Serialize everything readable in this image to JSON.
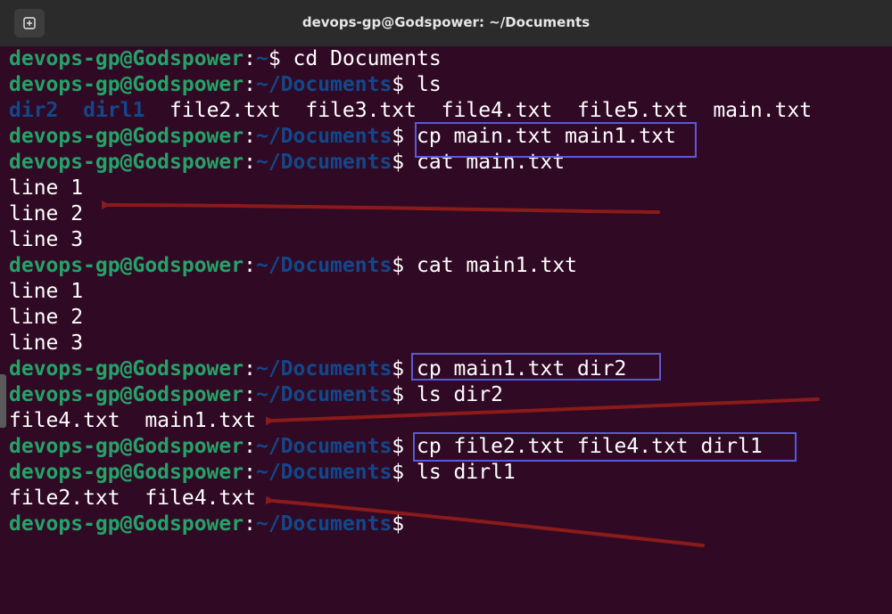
{
  "window": {
    "title": "devops-gp@Godspower: ~/Documents"
  },
  "prompt": {
    "user": "devops-gp@Godspower",
    "colon": ":",
    "dollar": "$"
  },
  "colors": {
    "user": "#26a269",
    "path": "#12488b",
    "text": "#ffffff",
    "background": "#300a24",
    "highlight_box": "#5a5ad6",
    "arrow": "#8b1a1a"
  },
  "lines": [
    {
      "type": "prompt",
      "path": "~",
      "cmd": " cd Documents"
    },
    {
      "type": "prompt",
      "path": "~/Documents",
      "cmd": " ls"
    },
    {
      "type": "ls",
      "dirs": [
        "dir2",
        "dirl1"
      ],
      "files": "file2.txt  file3.txt  file4.txt  file5.txt  main.txt"
    },
    {
      "type": "prompt",
      "path": "~/Documents",
      "cmd": " cp main.txt main1.txt"
    },
    {
      "type": "prompt",
      "path": "~/Documents",
      "cmd": " cat main.txt"
    },
    {
      "type": "out",
      "text": "line 1"
    },
    {
      "type": "out",
      "text": "line 2"
    },
    {
      "type": "out",
      "text": "line 3"
    },
    {
      "type": "prompt",
      "path": "~/Documents",
      "cmd": " cat main1.txt"
    },
    {
      "type": "out",
      "text": "line 1"
    },
    {
      "type": "out",
      "text": "line 2"
    },
    {
      "type": "out",
      "text": "line 3"
    },
    {
      "type": "prompt",
      "path": "~/Documents",
      "cmd": " cp main1.txt dir2"
    },
    {
      "type": "prompt",
      "path": "~/Documents",
      "cmd": " ls dir2"
    },
    {
      "type": "out",
      "text": "file4.txt  main1.txt"
    },
    {
      "type": "prompt",
      "path": "~/Documents",
      "cmd": " cp file2.txt file4.txt dirl1"
    },
    {
      "type": "prompt",
      "path": "~/Documents",
      "cmd": " ls dirl1"
    },
    {
      "type": "out",
      "text": "file2.txt  file4.txt"
    },
    {
      "type": "prompt",
      "path": "~/Documents",
      "cmd": ""
    }
  ]
}
